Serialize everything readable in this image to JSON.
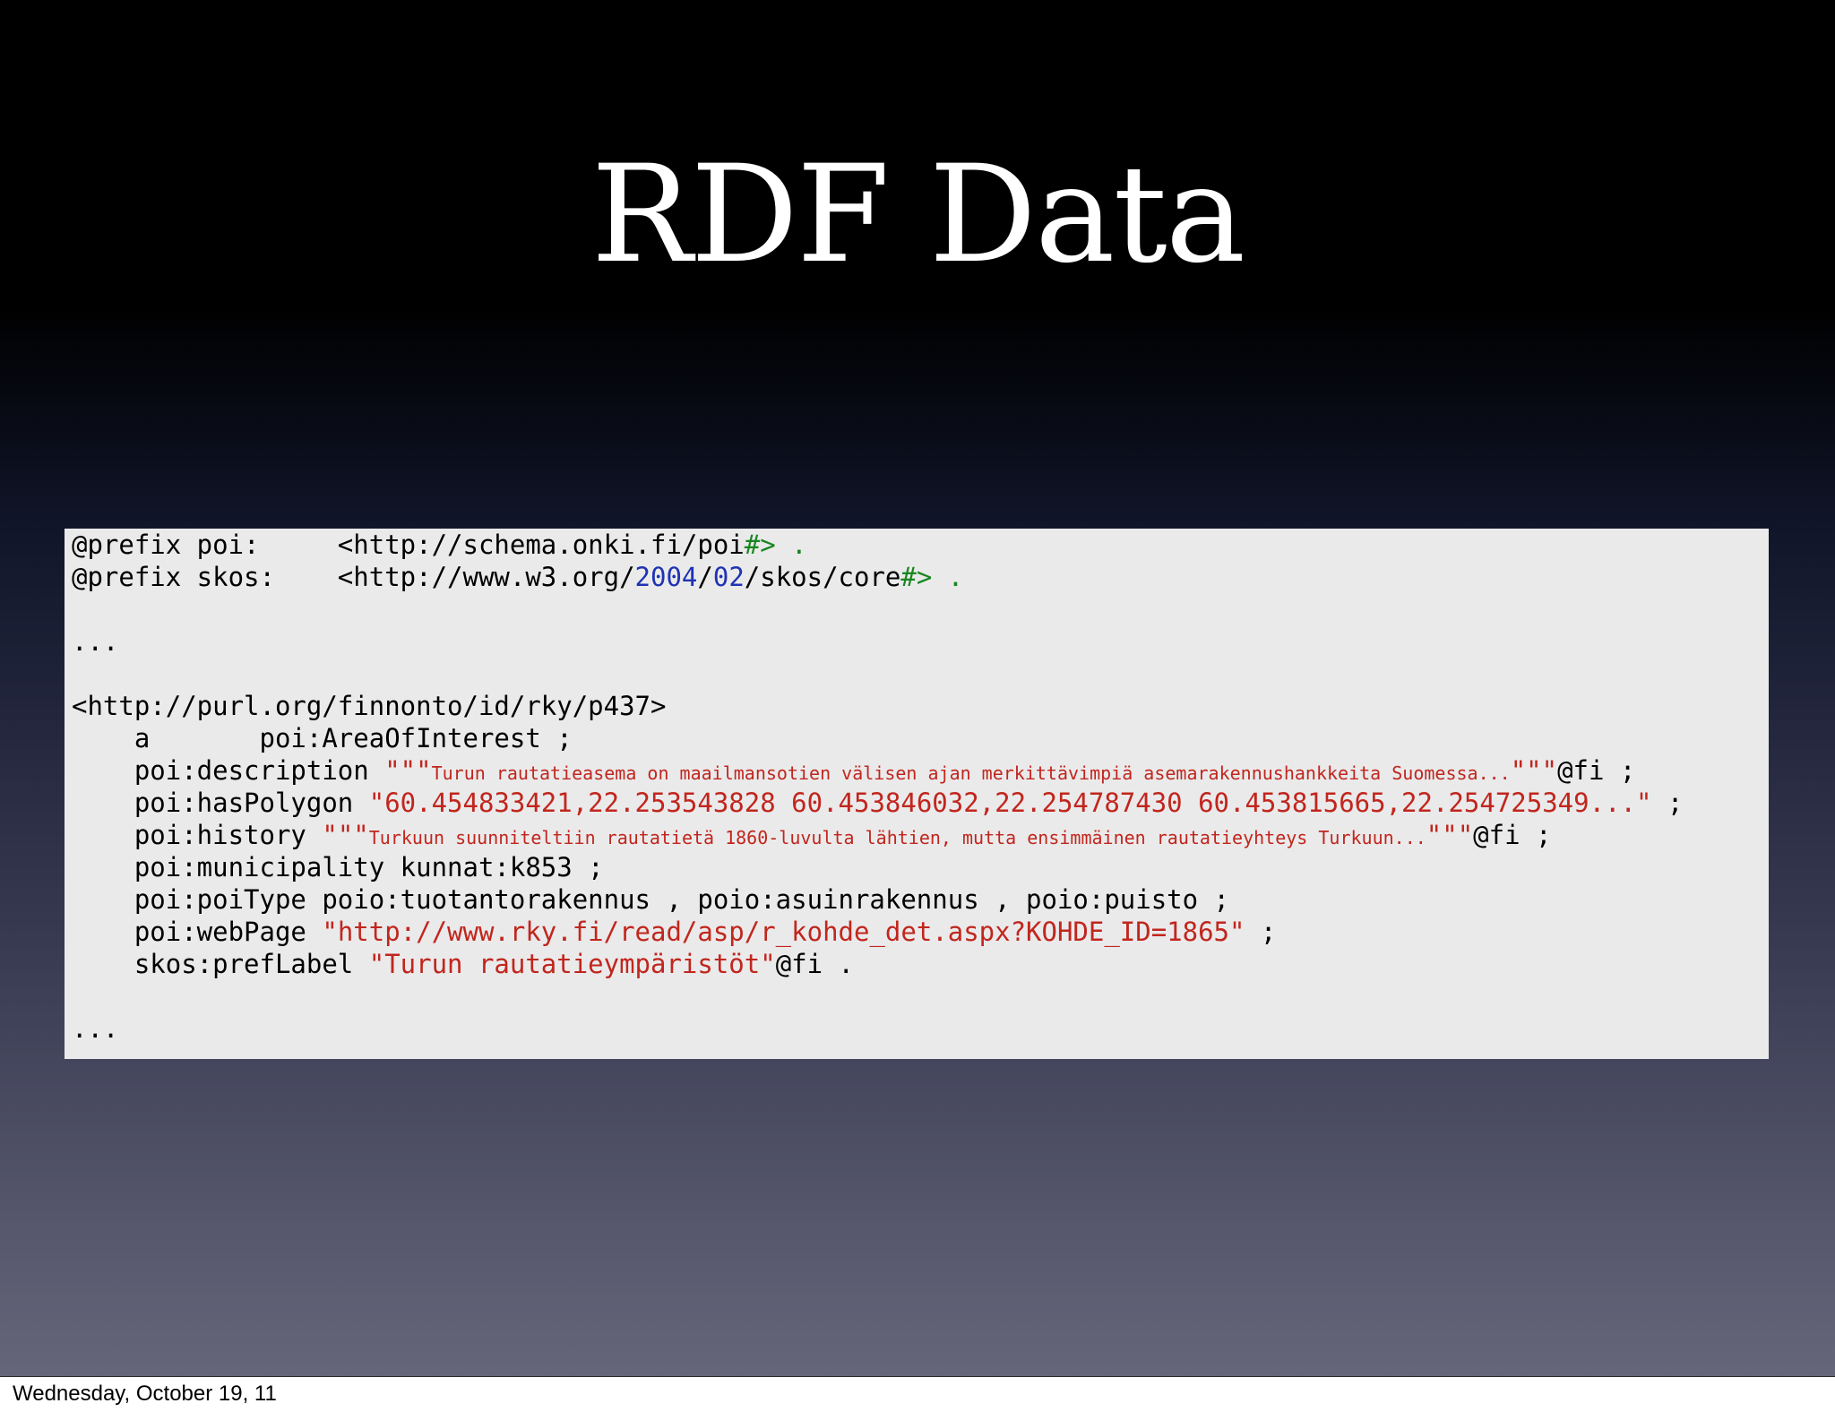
{
  "slide": {
    "title": "RDF Data",
    "footer": "Wednesday, October 19, 11"
  },
  "code": {
    "l1a": "@prefix poi:     <http://schema.onki.fi/poi",
    "l1b": "#> .",
    "l2a": "@prefix skos:    <http://www.w3.org/",
    "l2b": "2004",
    "l2c": "/",
    "l2d": "02",
    "l2e": "/skos/core",
    "l2f": "#> .",
    "l4": "...",
    "l6": "<http://purl.org/finnonto/id/rky/p437>",
    "l7": "    a       poi:AreaOfInterest ;",
    "l8a": "    poi:description ",
    "l8b": "\"\"\"",
    "l8c": "Turun rautatieasema on maailmansotien välisen ajan merkittävimpiä asemarakennushankkeita Suomessa...",
    "l8d": "\"\"\"",
    "l8e": "@fi ;",
    "l9a": "    poi:hasPolygon ",
    "l9b": "\"60.454833421,22.253543828 60.453846032,22.254787430 60.453815665,22.254725349...\"",
    "l9c": " ;",
    "l10a": "    poi:history ",
    "l10b": "\"\"\"",
    "l10c": "Turkuun suunniteltiin rautatietä 1860-luvulta lähtien, mutta ensimmäinen rautatieyhteys Turkuun...",
    "l10d": "\"\"\"",
    "l10e": "@fi ;",
    "l11": "    poi:municipality kunnat:k853 ;",
    "l12": "    poi:poiType poio:tuotantorakennus , poio:asuinrakennus , poio:puisto ;",
    "l13a": "    poi:webPage ",
    "l13b": "\"http://www.rky.fi/read/asp/r_kohde_det.aspx?KOHDE_ID=1865\"",
    "l13c": " ;",
    "l14a": "    skos:prefLabel ",
    "l14b": "\"Turun rautatieympäristöt\"",
    "l14c": "@fi .",
    "l16": "..."
  },
  "colors": {
    "string": "#c1261d",
    "number": "#1f33b4",
    "punctuation": "#18861f",
    "code_background": "#eaeaeb"
  }
}
